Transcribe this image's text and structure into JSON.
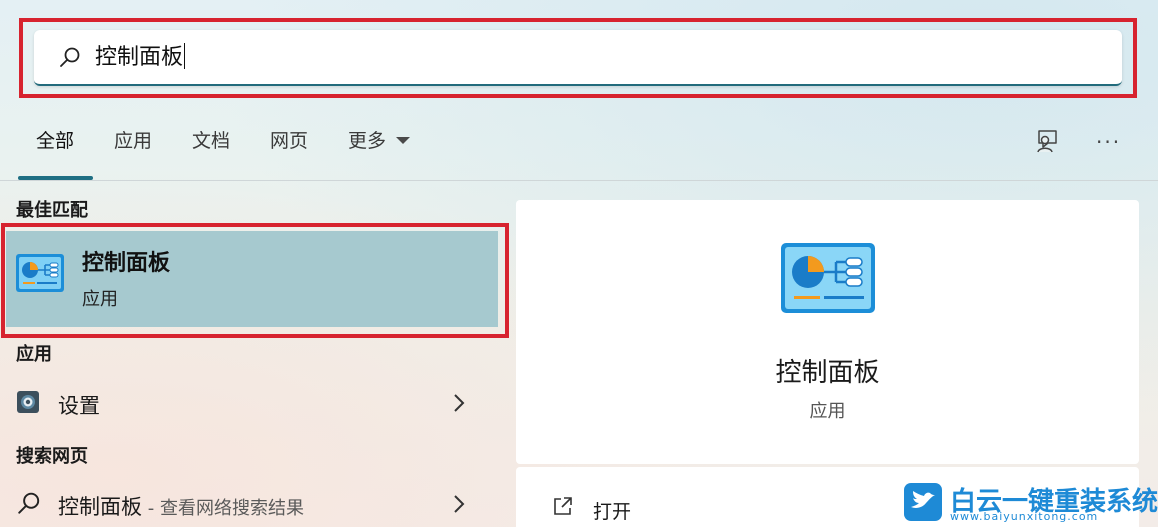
{
  "search": {
    "query": "控制面板"
  },
  "tabs": [
    {
      "label": "全部"
    },
    {
      "label": "应用"
    },
    {
      "label": "文档"
    },
    {
      "label": "网页"
    },
    {
      "label": "更多"
    }
  ],
  "toolbar": {
    "more_glyph": "···"
  },
  "best_match": {
    "section": "最佳匹配",
    "title": "控制面板",
    "subtitle": "应用",
    "icon": "control-panel-icon"
  },
  "apps": {
    "section": "应用",
    "items": [
      {
        "label": "设置",
        "icon": "settings-icon"
      }
    ]
  },
  "web": {
    "section": "搜索网页",
    "items": [
      {
        "label": "控制面板",
        "sub": " - 查看网络搜索结果",
        "icon": "search-icon"
      }
    ]
  },
  "details": {
    "title": "控制面板",
    "subtitle": "应用",
    "actions": [
      {
        "label": "打开",
        "icon": "open-icon"
      }
    ]
  },
  "watermark": {
    "name": "白云一键重装系统",
    "url": "www.baiyunxitong.com"
  },
  "colors": {
    "highlight": "#d7232f",
    "accent": "#1f6f83",
    "selected_row": "#a6c9cf"
  }
}
